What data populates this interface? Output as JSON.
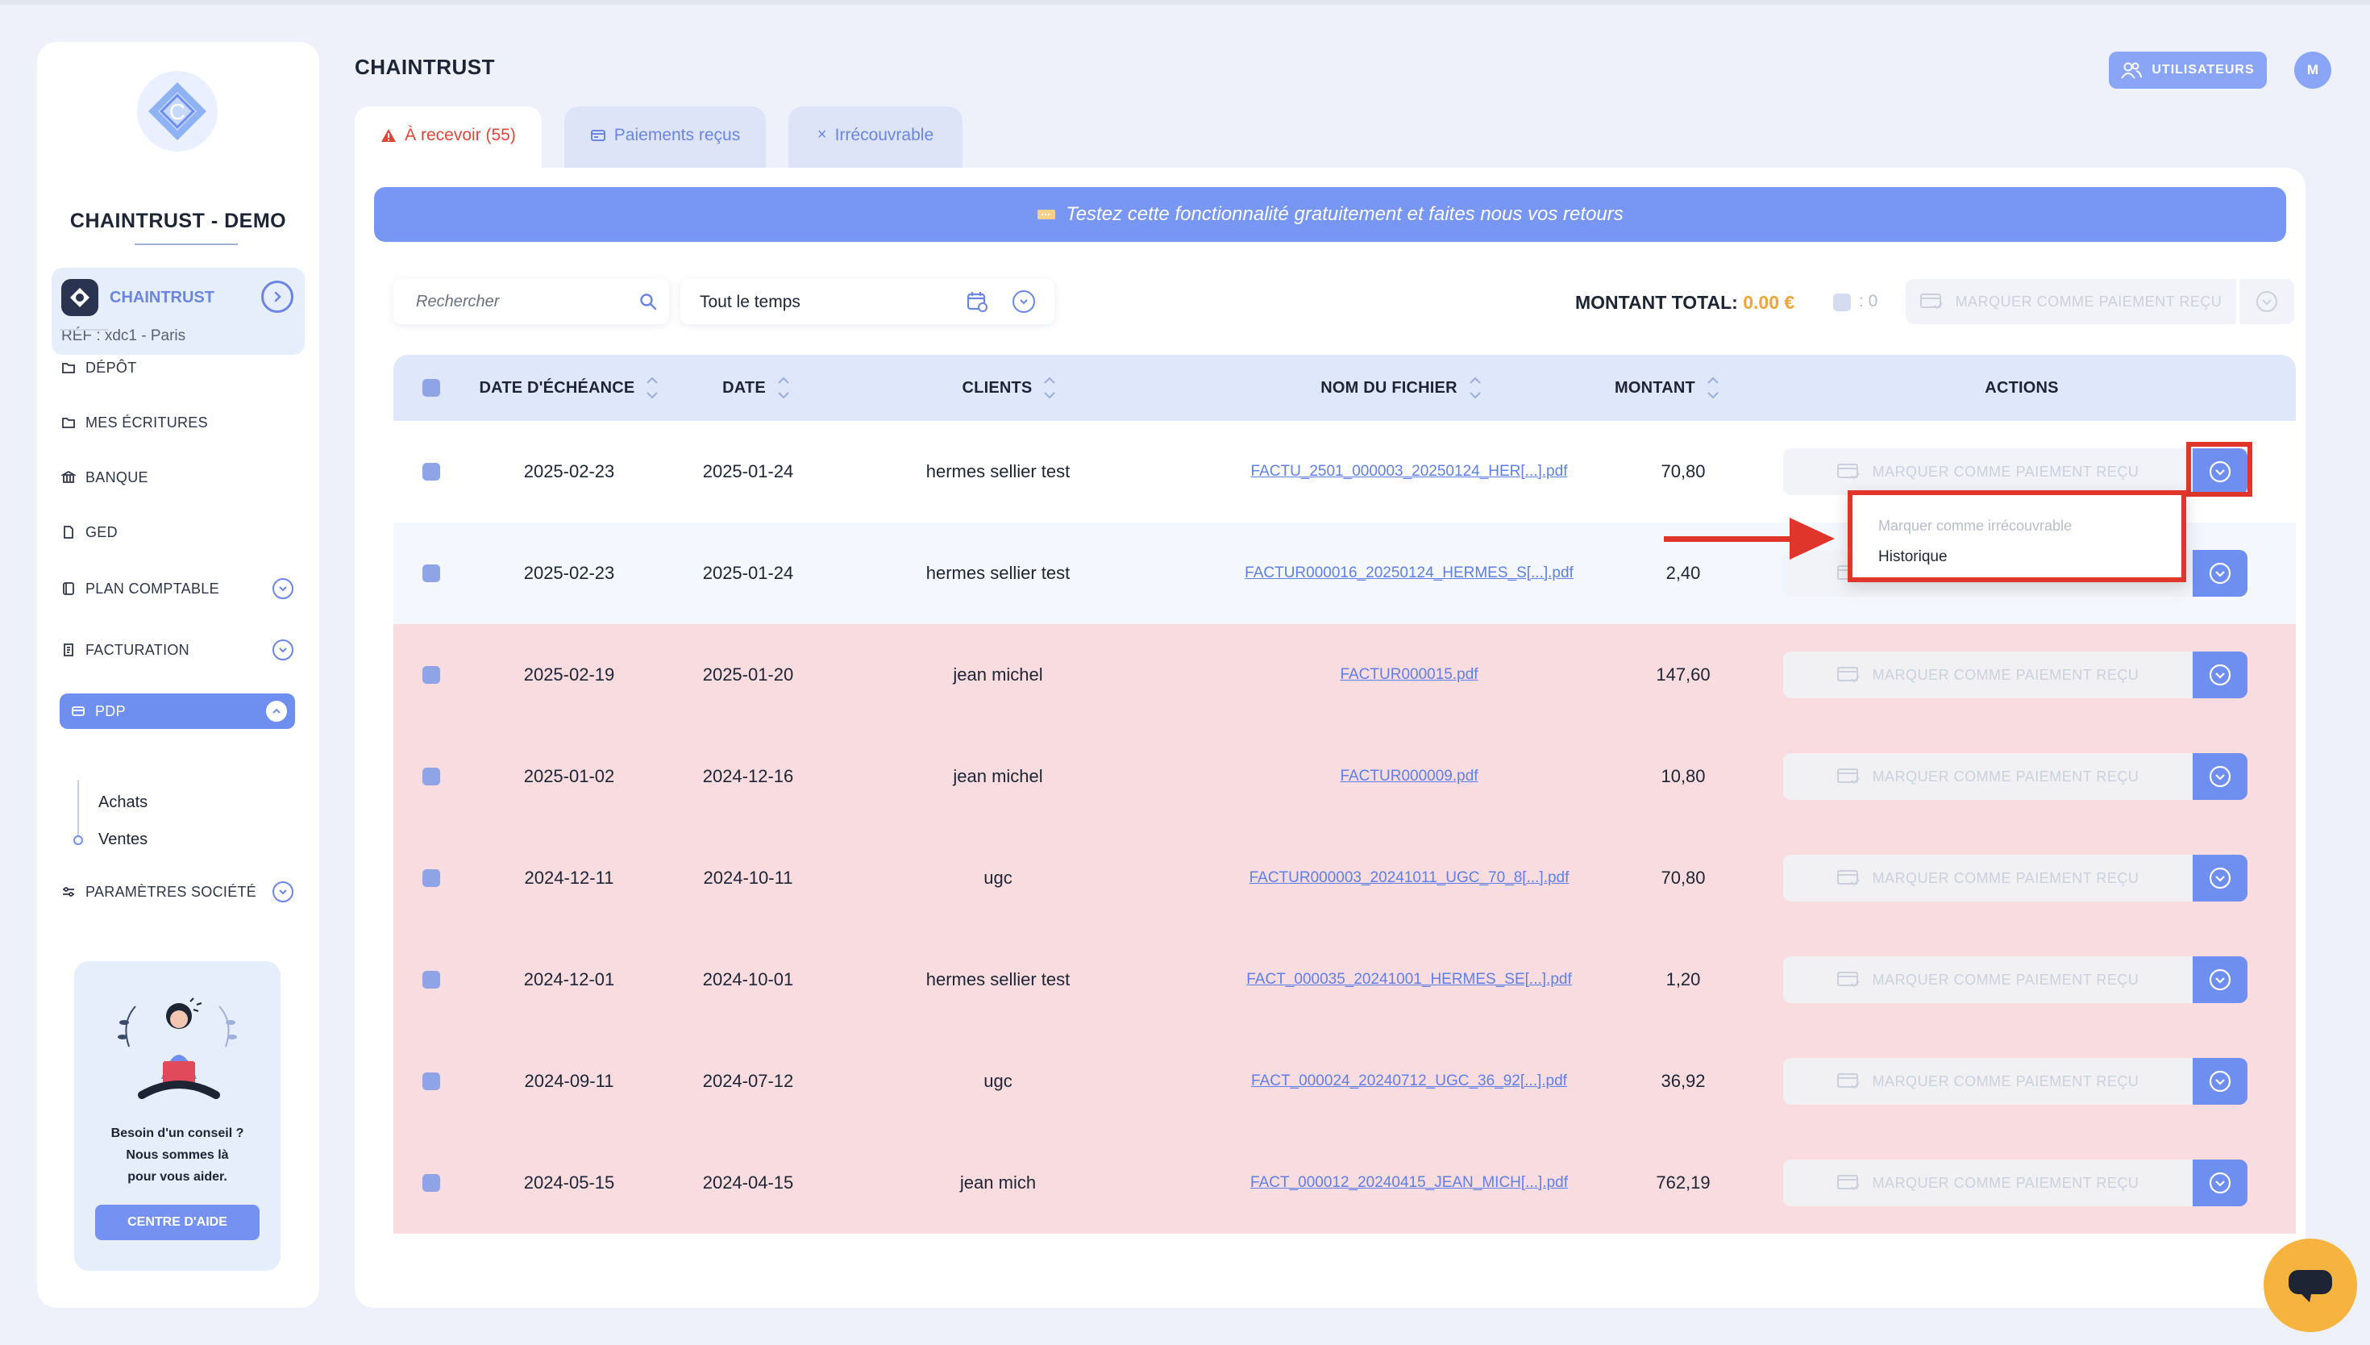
{
  "sidebar": {
    "company_name": "CHAINTRUST - DEMO",
    "org": {
      "name": "CHAINTRUST",
      "ref": "RÉF : xdc1 - Paris"
    },
    "nav": [
      {
        "label": "DÉPÔT",
        "icon": "folder-icon"
      },
      {
        "label": "MES ÉCRITURES",
        "icon": "folder-icon"
      },
      {
        "label": "BANQUE",
        "icon": "bank-icon"
      },
      {
        "label": "GED",
        "icon": "document-icon"
      },
      {
        "label": "PLAN COMPTABLE",
        "icon": "book-icon"
      },
      {
        "label": "FACTURATION",
        "icon": "invoice-icon"
      },
      {
        "label": "PDP",
        "icon": "card-icon"
      },
      {
        "label": "PARAMÈTRES SOCIÉTÉ",
        "icon": "sliders-icon"
      }
    ],
    "sub_items": [
      "Achats",
      "Ventes"
    ],
    "help": {
      "line1": "Besoin d'un conseil ?",
      "line2": "Nous sommes là",
      "line3": "pour vous aider.",
      "button": "CENTRE D'AIDE"
    }
  },
  "header": {
    "title": "CHAINTRUST",
    "users_button": "UTILISATEURS",
    "avatar_initial": "M"
  },
  "tabs": [
    {
      "label": "À recevoir (55)",
      "active": true
    },
    {
      "label": "Paiements reçus",
      "active": false
    },
    {
      "label": "Irrécouvrable",
      "active": false
    }
  ],
  "banner": "Testez cette fonctionnalité gratuitement et faites nous vos retours",
  "toolbar": {
    "search_placeholder": "Rechercher",
    "period": "Tout le temps",
    "total_label": "MONTANT TOTAL:",
    "total_value": "0.00 €",
    "selected_count": ": 0",
    "mark_button": "MARQUER COMME PAIEMENT REÇU"
  },
  "table": {
    "columns": [
      "DATE D'ÉCHÉANCE",
      "DATE",
      "CLIENTS",
      "NOM DU FICHIER",
      "MONTANT",
      "ACTIONS"
    ],
    "action_label": "MARQUER COMME PAIEMENT REÇU",
    "rows": [
      {
        "due": "2025-02-23",
        "date": "2025-01-24",
        "client": "hermes sellier test",
        "file": "FACTU_2501_000003_20250124_HER[...].pdf",
        "amount": "70,80",
        "overdue": false
      },
      {
        "due": "2025-02-23",
        "date": "2025-01-24",
        "client": "hermes sellier test",
        "file": "FACTUR000016_20250124_HERMES_S[...].pdf",
        "amount": "2,40",
        "overdue": false
      },
      {
        "due": "2025-02-19",
        "date": "2025-01-20",
        "client": "jean michel",
        "file": "FACTUR000015.pdf",
        "amount": "147,60",
        "overdue": true
      },
      {
        "due": "2025-01-02",
        "date": "2024-12-16",
        "client": "jean michel",
        "file": "FACTUR000009.pdf",
        "amount": "10,80",
        "overdue": true
      },
      {
        "due": "2024-12-11",
        "date": "2024-10-11",
        "client": "ugc",
        "file": "FACTUR000003_20241011_UGC_70_8[...].pdf",
        "amount": "70,80",
        "overdue": true
      },
      {
        "due": "2024-12-01",
        "date": "2024-10-01",
        "client": "hermes sellier test",
        "file": "FACT_000035_20241001_HERMES_SE[...].pdf",
        "amount": "1,20",
        "overdue": true
      },
      {
        "due": "2024-09-11",
        "date": "2024-07-12",
        "client": "ugc",
        "file": "FACT_000024_20240712_UGC_36_92[...].pdf",
        "amount": "36,92",
        "overdue": true
      },
      {
        "due": "2024-05-15",
        "date": "2024-04-15",
        "client": "jean mich",
        "file": "FACT_000012_20240415_JEAN_MICH[...].pdf",
        "amount": "762,19",
        "overdue": true
      }
    ]
  },
  "dropdown": {
    "items": [
      "Marquer comme irrécouvrable",
      "Historique"
    ]
  },
  "colors": {
    "accent": "#6f8ff0",
    "overdue_row": "#f9dcdf",
    "highlight": "#e0352a",
    "total_value": "#f0a43a",
    "active_tab": "#e0453a"
  }
}
